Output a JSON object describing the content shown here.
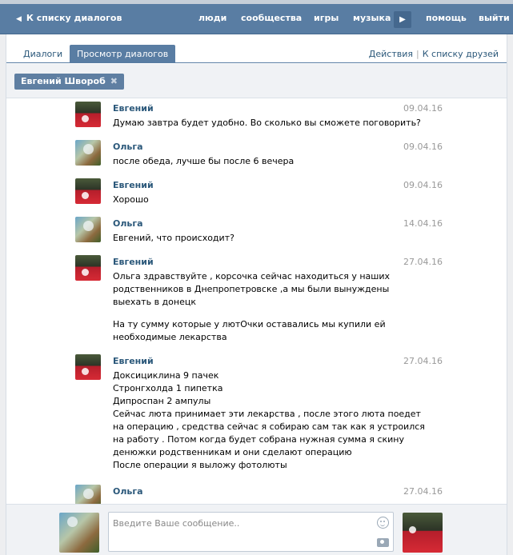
{
  "header": {
    "back_label": "К списку диалогов",
    "nav": [
      "люди",
      "сообщества",
      "игры",
      "музыка",
      "помощь",
      "выйти"
    ],
    "more_arrow": "▶"
  },
  "tabs": {
    "dialogs": "Диалоги",
    "view_dialogs": "Просмотр диалогов",
    "actions": "Действия",
    "separator": "|",
    "friends_list": "К списку друзей"
  },
  "filter": {
    "chip_label": "Евгений Швороб",
    "chip_close": "✖"
  },
  "messages": [
    {
      "author": "Евгений",
      "date": "09.04.16",
      "paragraphs": [
        [
          "Думаю завтра будет удобно. Во сколько вы сможете поговорить?"
        ]
      ]
    },
    {
      "author": "Ольга",
      "date": "09.04.16",
      "paragraphs": [
        [
          "после обеда, лучше бы после 6 вечера"
        ]
      ]
    },
    {
      "author": "Евгений",
      "date": "09.04.16",
      "paragraphs": [
        [
          "Хорошо"
        ]
      ]
    },
    {
      "author": "Ольга",
      "date": "14.04.16",
      "paragraphs": [
        [
          "Евгений, что происходит?"
        ]
      ]
    },
    {
      "author": "Евгений",
      "date": "27.04.16",
      "paragraphs": [
        [
          "Ольга здравствуйте , корсочка сейчас находиться у наших",
          "родственников в Днепропетровске ,а мы были вынуждены",
          "выехать в донецк"
        ],
        [
          "На ту сумму которые у лютОчки оставались мы купили ей",
          "необходимые лекарства"
        ]
      ]
    },
    {
      "author": "Евгений",
      "date": "27.04.16",
      "paragraphs": [
        [
          "Доксициклина 9 пачек",
          "Стронгхолда 1 пипетка",
          "Дипроспан 2 ампулы",
          "Сейчас люта принимает эти лекарства , после этого люта поедет",
          "на операцию , средства сейчас я собираю сам так как я устроился",
          "на работу . Потом когда будет собрана нужная сумма я скину",
          "денюжки родственникам и они сделают операцию",
          "После операции я выложу фотолюты"
        ]
      ]
    },
    {
      "author": "Ольга",
      "date": "27.04.16",
      "paragraphs": [
        [
          ""
        ]
      ]
    }
  ],
  "composer": {
    "placeholder": "Введите Ваше сообщение.."
  }
}
